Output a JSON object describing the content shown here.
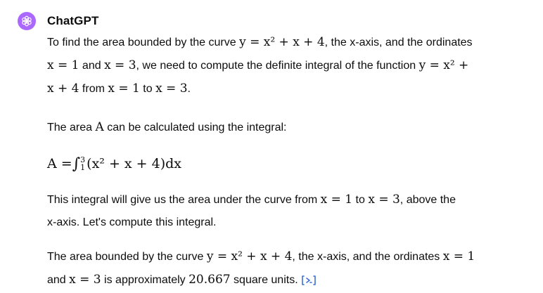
{
  "message": {
    "author": "ChatGPT",
    "p1": {
      "t1": "To find the area bounded by the curve ",
      "m1": "y = x² + x + 4",
      "t2": ", the x-axis, and the ordinates",
      "m2": "x = 1",
      "t3": " and ",
      "m3": "x = 3",
      "t4": ", we need to compute the definite integral of the function ",
      "m4": "y = x² +",
      "m5": "x + 4",
      "t5": " from ",
      "m6": "x = 1",
      "t6": " to ",
      "m7": "x = 3",
      "t7": "."
    },
    "p2": {
      "t1": "The area ",
      "m1": "A",
      "t2": " can be calculated using the integral:"
    },
    "formula": {
      "lhs": "A = ",
      "upper": "3",
      "lower": "1",
      "body": "(x² + x + 4)dx"
    },
    "p3": {
      "t1": "This integral will give us the area under the curve from ",
      "m1": "x = 1",
      "t2": " to ",
      "m2": "x = 3",
      "t3": ", above the",
      "t4": "x-axis. Let's compute this integral."
    },
    "p4": {
      "t1": "The area bounded by the curve ",
      "m1": "y = x² + x + 4",
      "t2": ", the x-axis, and the ordinates ",
      "m2": "x = 1",
      "t3": "and ",
      "m3": "x = 3",
      "t4": " is approximately ",
      "m4": "20.667",
      "t5": " square units."
    },
    "source_icon": "code-source-icon",
    "colors": {
      "avatar_bg": "#ab68ff",
      "link": "#3a6fd8",
      "text": "#0d0d0d"
    }
  }
}
